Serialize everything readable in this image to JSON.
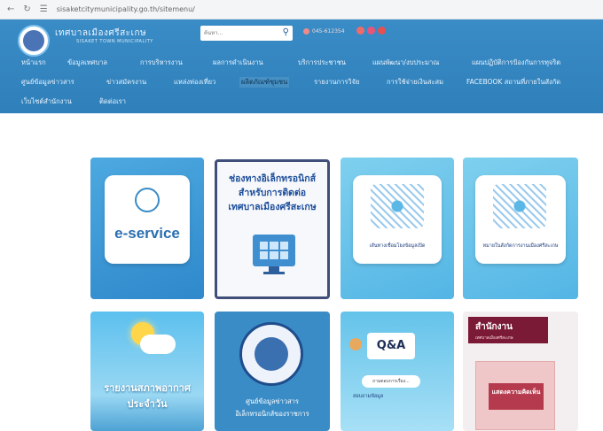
{
  "browser": {
    "url": "sisaketcitymunicipality.go.th/sitemenu/"
  },
  "header": {
    "site_name": "เทศบาลเมืองศรีสะเกษ",
    "site_sub": "SISAKET TOWN MUNICIPALITY",
    "search_placeholder": "ค้นหา...",
    "phone": "045-612354"
  },
  "nav": {
    "row1": [
      "หน้าแรก",
      "ข้อมูลเทศบาล",
      "การบริหารงาน",
      "ผลการดำเนินงาน",
      "บริการประชาชน",
      "แผนพัฒนา/งบประมาณ",
      "แผนปฏิบัติการป้องกันการทุจริต"
    ],
    "row2": [
      "ศูนย์ข้อมูลข่าวสาร",
      "ข่าวสมัครงาน",
      "แหล่งท่องเที่ยว",
      "ผลิตภัณฑ์ชุมชน",
      "รายงานการวิจัย",
      "การใช้จ่ายเงินสะสม",
      "FACEBOOK สถานที่ภายในสังกัด"
    ],
    "row3": [
      "เว็บไซต์สำนักงาน",
      "ติดต่อเรา"
    ]
  },
  "cards": {
    "c1": {
      "title": "e-service"
    },
    "c2": {
      "line1": "ช่องทางอิเล็กทรอนิกส์",
      "line2": "สำหรับการติดต่อ",
      "line3": "เทศบาลเมืองศรีสะเกษ"
    },
    "c3": {
      "caption": "เส้นทางเชื่อมโยงข้อมูลเปิด"
    },
    "c4": {
      "caption": "หมายในสังกัดการงานเมืองศรีสะเกษ"
    },
    "c5": {
      "line1": "รายงานสภาพอากาศ",
      "line2": "ประจำวัน"
    },
    "c6": {
      "line1": "ศูนย์ข้อมูลข่าวสาร",
      "line2": "อิเล็กทรอนิกส์ของราชการ"
    },
    "c7": {
      "qa": "Q&A",
      "sub": "ถามตอบการเรื่อง...",
      "foot": "สอบถามข้อมูล"
    },
    "c8": {
      "head": "สำนักงาน",
      "head_sub": "เทศบาลเมืองศรีสะเกษ",
      "box_label_1": "แสดงความคิดเห็น",
      "box_label_2": ""
    }
  },
  "colors": {
    "header_blue": "#3a8cc6",
    "nav_text": "#eaf4ff",
    "brand_dark": "#1f4d8c"
  },
  "icons": {
    "search": "search-icon",
    "phone": "phone-icon"
  }
}
